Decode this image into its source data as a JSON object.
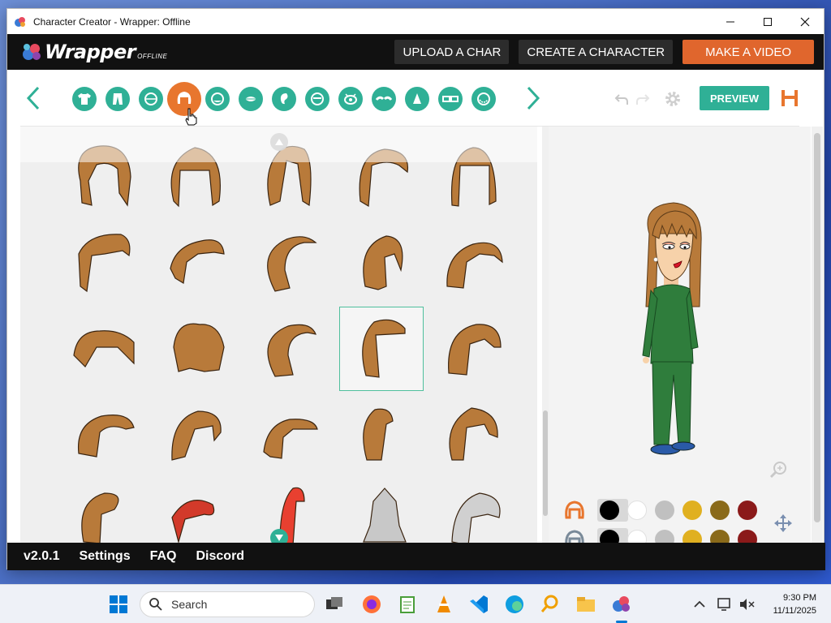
{
  "window": {
    "title": "Character Creator - Wrapper: Offline",
    "controls": [
      "minimize",
      "maximize",
      "close"
    ]
  },
  "appbar": {
    "logo_text": "Wrapper",
    "logo_sub": "OFFLINE",
    "buttons": [
      {
        "label": "UPLOAD A CHAR"
      },
      {
        "label": "CREATE A CHARACTER"
      },
      {
        "label": "MAKE A VIDEO"
      }
    ]
  },
  "toolbar": {
    "categories": [
      {
        "icon": "shirt-icon"
      },
      {
        "icon": "pants-icon"
      },
      {
        "icon": "face-shape-icon"
      },
      {
        "icon": "hair-icon",
        "active": true
      },
      {
        "icon": "head-icon"
      },
      {
        "icon": "mouth-icon"
      },
      {
        "icon": "ear-icon"
      },
      {
        "icon": "eyebrow-shape-icon"
      },
      {
        "icon": "eye-icon"
      },
      {
        "icon": "eyebrows-icon"
      },
      {
        "icon": "nose-icon"
      },
      {
        "icon": "glasses-icon"
      },
      {
        "icon": "beard-icon"
      }
    ],
    "preview_label": "PREVIEW",
    "accent": "#2fb096",
    "active_color": "#e8762e",
    "brand_orange": "#e0662d"
  },
  "hair_grid": {
    "rows": 5,
    "cols": 5,
    "selected_index": 13,
    "hair_color": "#b87a3a"
  },
  "color_rows": [
    {
      "icon": "hair-color-icon",
      "swatches": [
        "#000000",
        "#ffffff",
        "#c0c0c0",
        "#e0b020",
        "#8a6a1a",
        "#8b1a1a"
      ]
    },
    {
      "icon": "hair-secondary-color-icon",
      "swatches": [
        "#000000",
        "#ffffff",
        "#c0c0c0",
        "#e0b020",
        "#8a6a1a",
        "#8b1a1a"
      ]
    }
  ],
  "bottombar": {
    "version": "v2.0.1",
    "links": [
      "Settings",
      "FAQ",
      "Discord"
    ]
  },
  "taskbar": {
    "search_placeholder": "Search",
    "time": "9:30 PM",
    "date": "11/11/2025"
  }
}
